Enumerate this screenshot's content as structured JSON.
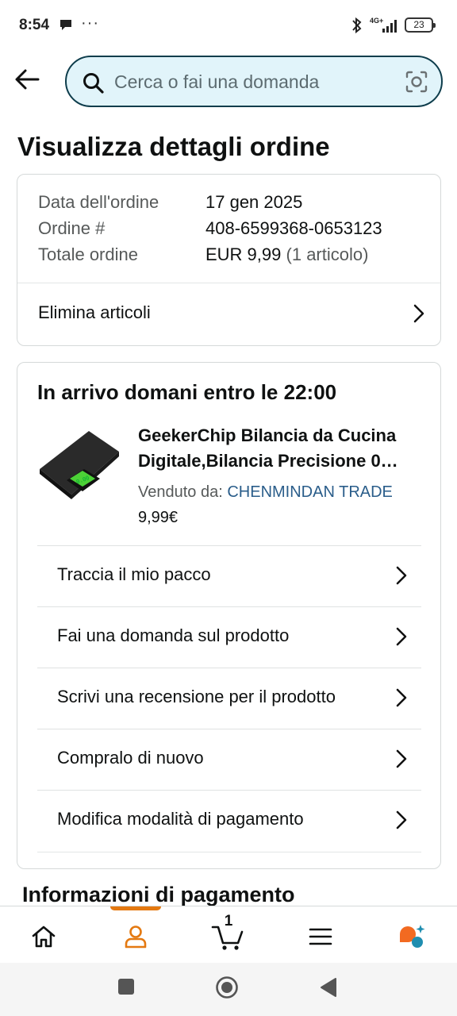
{
  "status_bar": {
    "time": "8:54",
    "dots": "···",
    "network": "4G+",
    "battery": "23"
  },
  "search": {
    "placeholder": "Cerca o fai una domanda"
  },
  "page_title": "Visualizza dettagli ordine",
  "order_summary": {
    "rows": [
      {
        "label": "Data dell'ordine",
        "value": "17 gen 2025",
        "extra": ""
      },
      {
        "label": "Ordine #",
        "value": "408-6599368-0653123",
        "extra": ""
      },
      {
        "label": "Totale ordine",
        "value": "EUR 9,99",
        "extra": "(1 articolo)"
      }
    ],
    "link_label": "Elimina articoli"
  },
  "shipment": {
    "title": "In arrivo domani entro le 22:00",
    "product": {
      "name_line1": "GeekerChip Bilancia da Cucina",
      "name_line2": "Digitale,Bilancia Precisione 0…",
      "seller_label": "Venduto da:",
      "seller_name": "CHENMINDAN TRADE",
      "price": "9,99€"
    },
    "actions": [
      {
        "label": "Traccia il mio pacco"
      },
      {
        "label": "Fai una domanda sul prodotto"
      },
      {
        "label": "Scrivi una recensione per il prodotto"
      },
      {
        "label": "Compralo di nuovo"
      },
      {
        "label": "Modifica modalità di pagamento"
      }
    ]
  },
  "next_section_title": "Informazioni di pagamento",
  "bottom_nav": {
    "cart_count": "1",
    "active_tab": "account",
    "accent_color": "#e47911"
  },
  "colors": {
    "search_bg": "#e1f4fa",
    "search_border": "#0e3d4c",
    "link": "#2a5d8a"
  }
}
